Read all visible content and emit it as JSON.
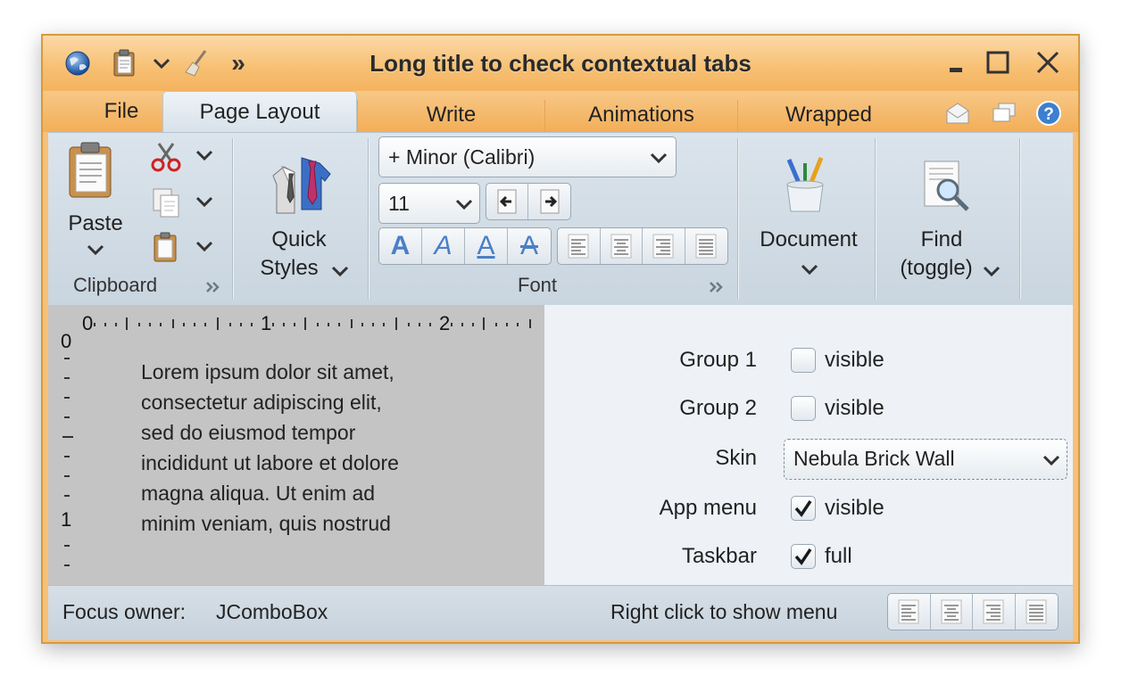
{
  "window": {
    "title": "Long title to check contextual tabs",
    "accent": "#f4b35f"
  },
  "quick_access": [
    {
      "icon": "globe-icon"
    },
    {
      "icon": "clipboard-icon"
    },
    {
      "icon": "chevron-down-icon"
    },
    {
      "icon": "broom-icon"
    },
    {
      "icon": "overflow-icon",
      "glyph": "»"
    }
  ],
  "tabs": [
    {
      "label": "File"
    },
    {
      "label": "Page Layout"
    },
    {
      "label": "Write"
    },
    {
      "label": "Animations"
    },
    {
      "label": "Wrapped"
    }
  ],
  "ribbon": {
    "clipboard": {
      "paste_label": "Paste",
      "band_label": "Clipboard"
    },
    "quick_styles": {
      "line1": "Quick",
      "line2": "Styles"
    },
    "font": {
      "family": "+ Minor (Calibri)",
      "size": "11",
      "band_label": "Font",
      "style_letters": [
        "A",
        "A",
        "A",
        "A"
      ]
    },
    "document": {
      "label": "Document"
    },
    "find": {
      "line1": "Find",
      "line2": "(toggle)"
    }
  },
  "document": {
    "ruler_top": [
      "0",
      "1",
      "2"
    ],
    "ruler_left": [
      "0",
      "1"
    ],
    "lines": [
      "Lorem ipsum dolor sit amet,",
      "consectetur adipiscing elit,",
      "sed do eiusmod tempor",
      "incididunt ut labore et dolore",
      "magna aliqua. Ut enim ad",
      "minim veniam, quis nostrud"
    ]
  },
  "settings": {
    "group1": {
      "label": "Group 1",
      "option": "visible",
      "checked": false
    },
    "group2": {
      "label": "Group 2",
      "option": "visible",
      "checked": false
    },
    "skin": {
      "label": "Skin",
      "value": "Nebula Brick Wall"
    },
    "app_menu": {
      "label": "App menu",
      "option": "visible",
      "checked": true
    },
    "taskbar": {
      "label": "Taskbar",
      "option": "full",
      "checked": true
    }
  },
  "status": {
    "focus_label": "Focus owner:",
    "focus_value": "JComboBox",
    "hint": "Right click to show menu"
  }
}
